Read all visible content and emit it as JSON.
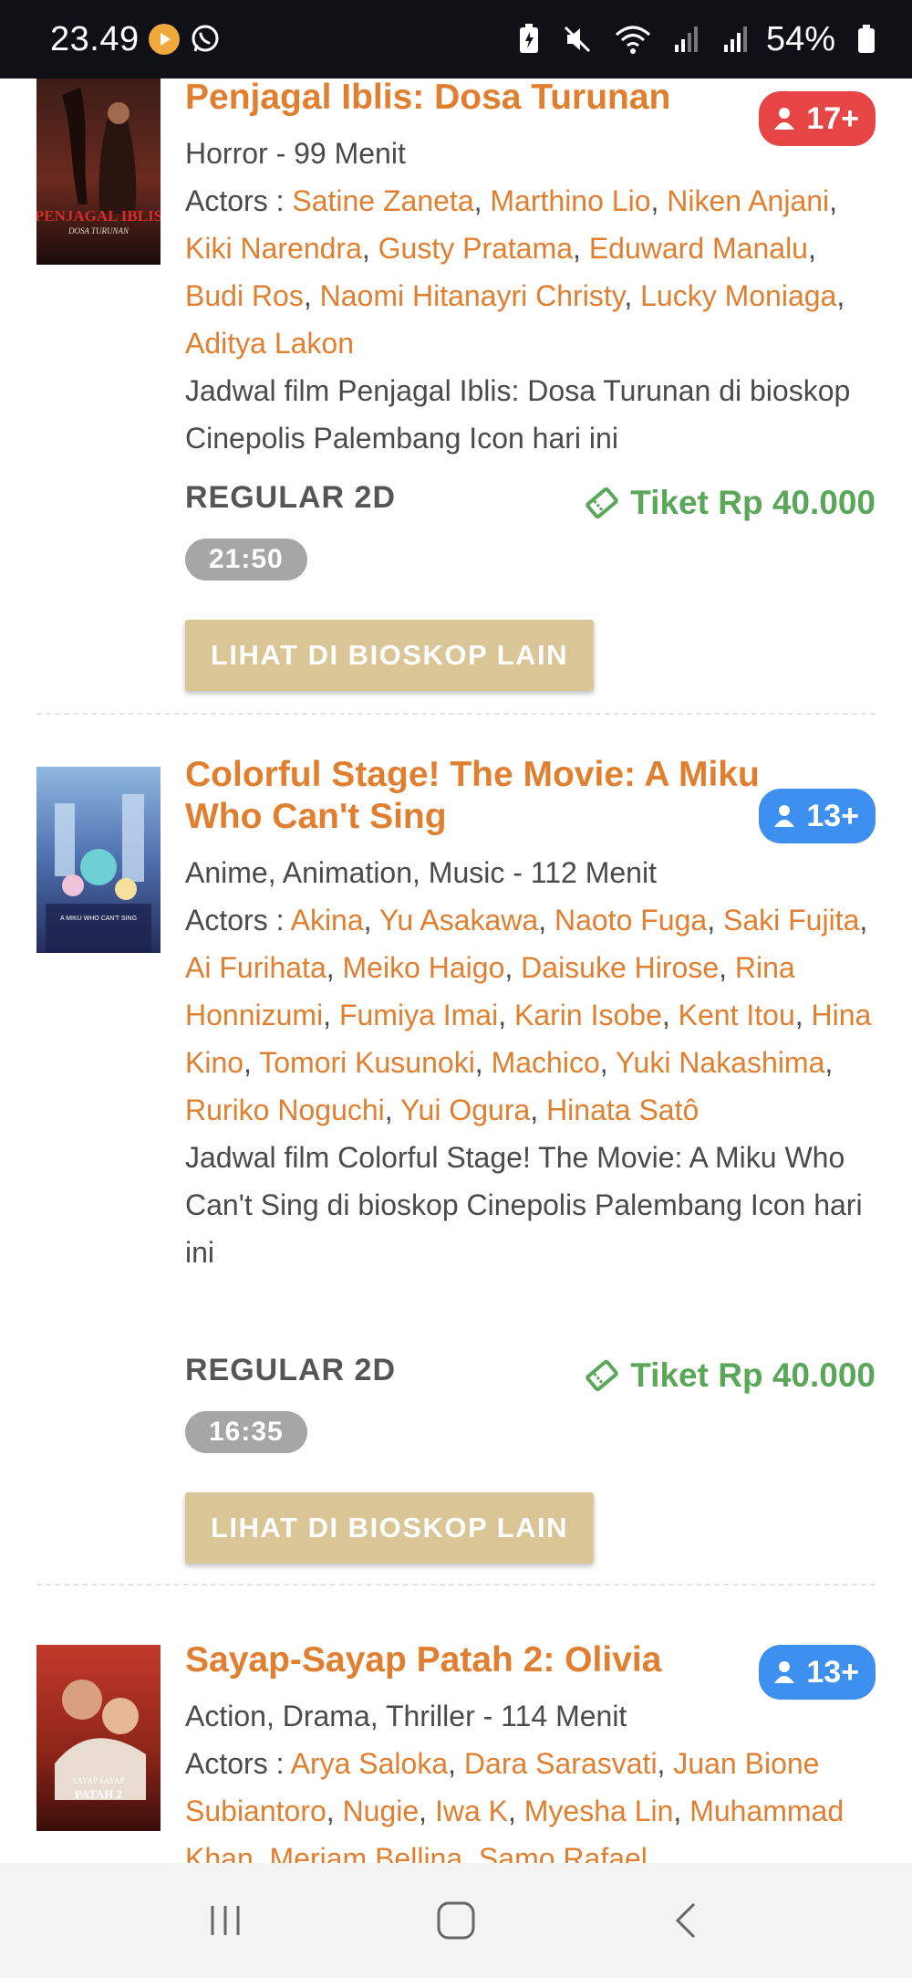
{
  "status_bar": {
    "time": "23.49",
    "battery": "54%",
    "icons": [
      "media-play-icon",
      "whatsapp-icon",
      "battery-saver-icon",
      "mute-icon",
      "wifi-icon",
      "signal-icon",
      "signal-icon",
      "battery-icon"
    ]
  },
  "movies": [
    {
      "title": "Penjagal Iblis: Dosa Turunan",
      "rating": "17+",
      "meta": "Horror - 99 Menit",
      "actors_label": "Actors :",
      "actors": [
        "Satine Zaneta",
        "Marthino Lio",
        "Niken Anjani",
        "Kiki Narendra",
        "Gusty Pratama",
        "Eduward Manalu",
        "Budi Ros",
        "Naomi Hitanayri Christy",
        "Lucky Moniaga",
        "Aditya Lakon"
      ],
      "description": "Jadwal film Penjagal Iblis: Dosa Turunan di bioskop Cinepolis Palembang Icon hari ini",
      "format": "REGULAR 2D",
      "ticket": "Tiket Rp 40.000",
      "showtimes": [
        "21:50"
      ],
      "cta": "LIHAT DI BIOSKOP LAIN",
      "poster_text": [
        "PENJAGAL IBLIS",
        "DOSA TURUNAN"
      ]
    },
    {
      "title": "Colorful Stage! The Movie: A Miku Who Can't Sing",
      "rating": "13+",
      "meta": "Anime, Animation, Music - 112 Menit",
      "actors_label": "Actors :",
      "actors": [
        "Akina",
        "Yu Asakawa",
        "Naoto Fuga",
        "Saki Fujita",
        "Ai Furihata",
        "Meiko Haigo",
        "Daisuke Hirose",
        "Rina Honnizumi",
        "Fumiya Imai",
        "Karin Isobe",
        "Kent Itou",
        "Hina Kino",
        "Tomori Kusunoki",
        "Machico",
        "Yuki Nakashima",
        "Ruriko Noguchi",
        "Yui Ogura",
        "Hinata Satô"
      ],
      "description": "Jadwal film Colorful Stage! The Movie: A Miku Who Can't Sing di bioskop Cinepolis Palembang Icon hari ini",
      "format": "REGULAR 2D",
      "ticket": "Tiket Rp 40.000",
      "showtimes": [
        "16:35"
      ],
      "cta": "LIHAT DI BIOSKOP LAIN",
      "poster_text": [
        "A MIKU WHO CAN'T SING"
      ]
    },
    {
      "title": "Sayap-Sayap Patah 2: Olivia",
      "rating": "13+",
      "meta": "Action, Drama, Thriller - 114 Menit",
      "actors_label": "Actors :",
      "actors": [
        "Arya Saloka",
        "Dara Sarasvati",
        "Juan Bione Subiantoro",
        "Nugie",
        "Iwa K",
        "Myesha Lin",
        "Muhammad Khan",
        "Meriam Bellina",
        "Samo Rafael"
      ],
      "poster_text": [
        "SAYAP SAYAP",
        "PATAH 2"
      ]
    }
  ],
  "colors": {
    "accent_orange": "#e07f2f",
    "rating_red": "#e74545",
    "rating_blue": "#3d8ff0",
    "ticket_green": "#5aa75a",
    "cta_gold": "#d9c596",
    "showtime_gray": "#a6a6a6"
  },
  "nav_bar": {
    "icons": [
      "recent-apps-icon",
      "home-icon",
      "back-icon"
    ]
  }
}
